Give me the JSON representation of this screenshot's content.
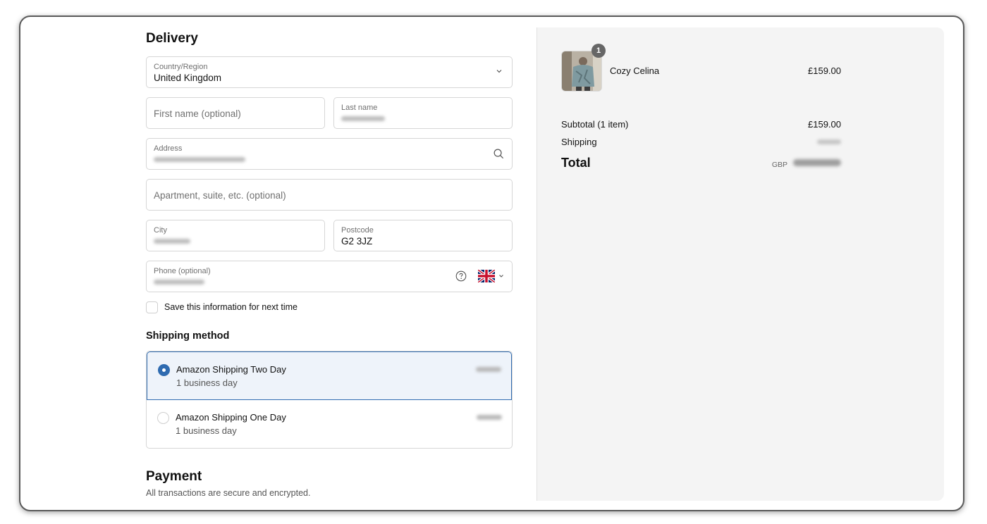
{
  "delivery": {
    "title": "Delivery",
    "country": {
      "label": "Country/Region",
      "value": "United Kingdom"
    },
    "first_name": {
      "placeholder": "First name (optional)"
    },
    "last_name": {
      "label": "Last name"
    },
    "address": {
      "label": "Address"
    },
    "apartment": {
      "placeholder": "Apartment, suite, etc. (optional)"
    },
    "city": {
      "label": "City"
    },
    "postcode": {
      "label": "Postcode",
      "value": "G2 3JZ"
    },
    "phone": {
      "label": "Phone (optional)"
    },
    "save_info": "Save this information for next time"
  },
  "shipping": {
    "title": "Shipping method",
    "options": [
      {
        "name": "Amazon Shipping Two Day",
        "eta": "1 business day",
        "selected": true
      },
      {
        "name": "Amazon Shipping One Day",
        "eta": "1 business day",
        "selected": false
      }
    ]
  },
  "payment": {
    "title": "Payment",
    "subtitle": "All transactions are secure and encrypted."
  },
  "summary": {
    "item": {
      "name": "Cozy Celina",
      "price": "£159.00",
      "quantity": "1"
    },
    "subtotal_label": "Subtotal (1 item)",
    "subtotal_value": "£159.00",
    "shipping_label": "Shipping",
    "total_label": "Total",
    "currency": "GBP"
  },
  "colors": {
    "accent": "#2f6bb0",
    "selected_bg": "#eef3fa",
    "summary_bg": "#f4f4f4"
  },
  "icons": [
    "chevron-down-icon",
    "search-icon",
    "help-circle-icon",
    "uk-flag-icon"
  ]
}
